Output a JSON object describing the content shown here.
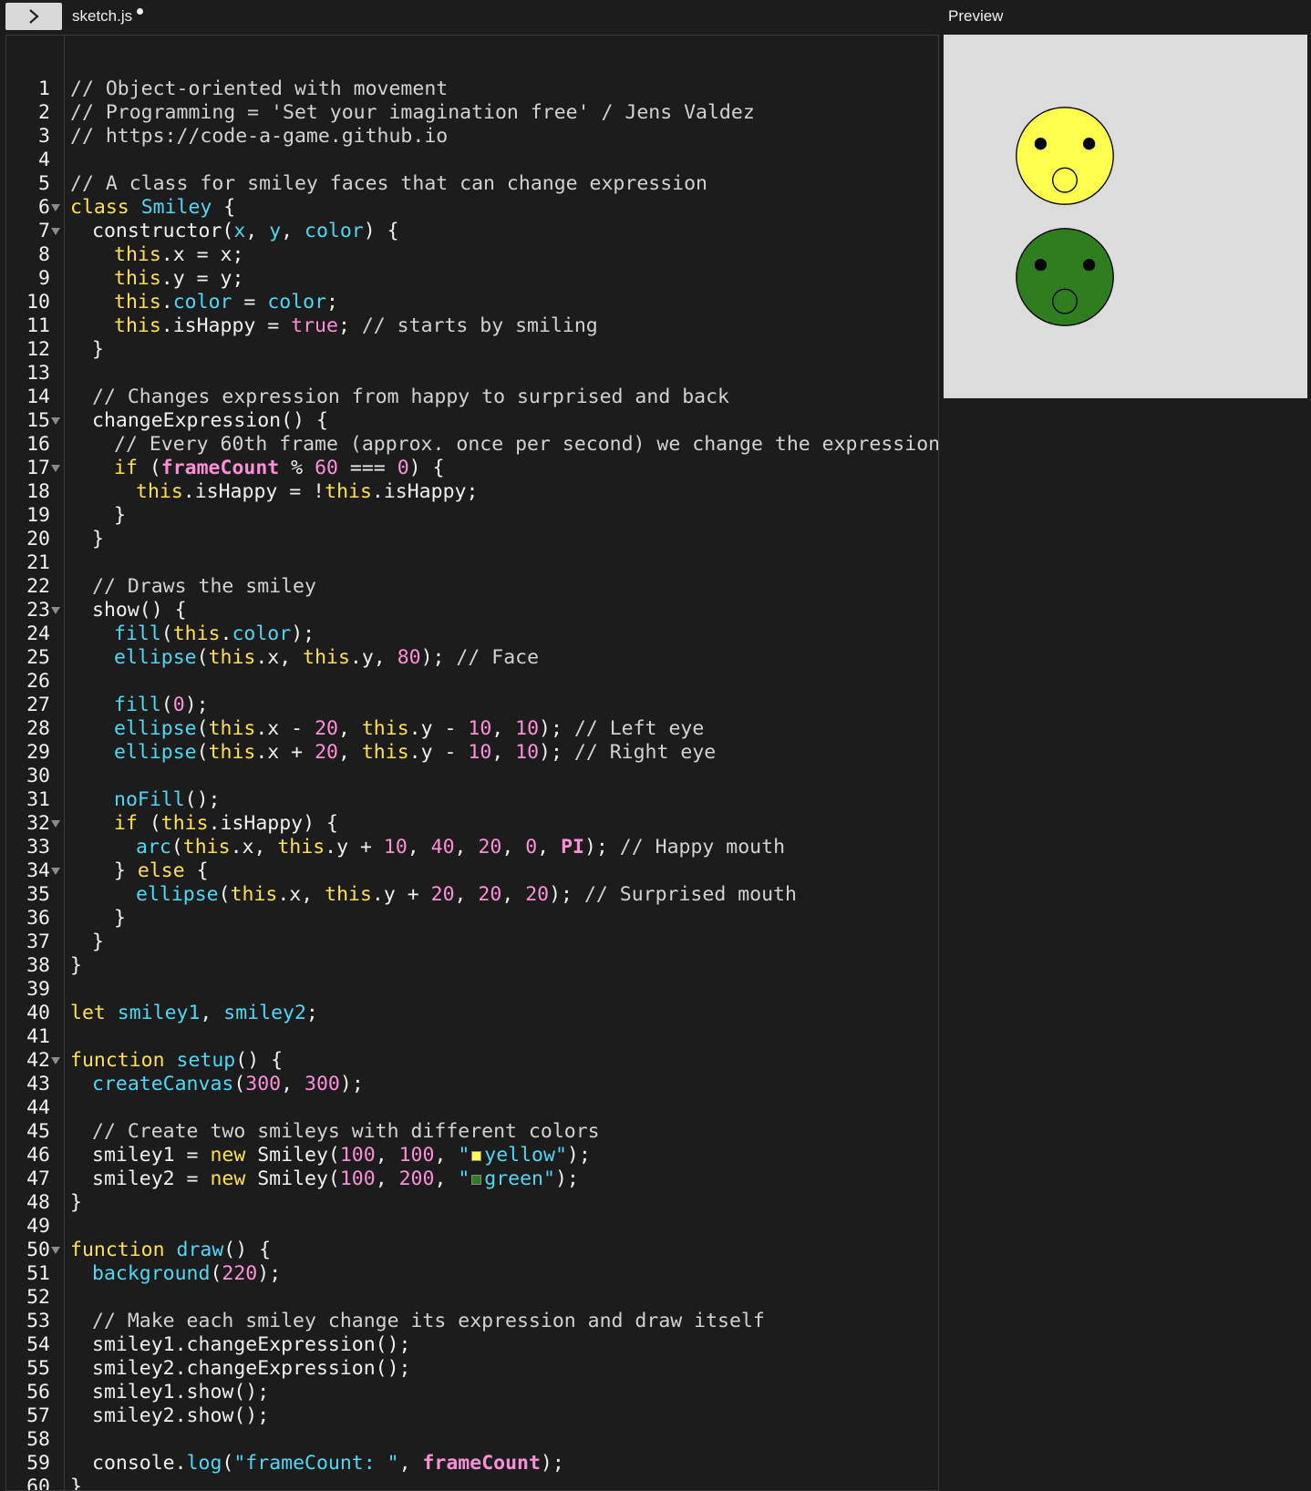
{
  "toolbar": {
    "toggle_icon": "chevron-right-icon"
  },
  "file_tab": {
    "name": "sketch.js"
  },
  "preview": {
    "label": "Preview",
    "background": "#dcdcdc",
    "smileys": [
      {
        "color": "#ffff4d",
        "expression": "surprised"
      },
      {
        "color": "#2e7d1e",
        "expression": "surprised"
      }
    ]
  },
  "colors": {
    "editor_bg": "#1c1c1c",
    "keyword": "#ffe14d",
    "function": "#4ed8f5",
    "number": "#ff8fd8",
    "swatch_yellow": "#ffff4d",
    "swatch_green": "#2e7d1e"
  },
  "code": {
    "l1": "// Object-oriented with movement",
    "l2": "// Programming = 'Set your imagination free' / Jens Valdez",
    "l3": "// https://code-a-game.github.io",
    "l5": "// A class for smiley faces that can change expression",
    "l14": "// Changes expression from happy to surprised and back",
    "l16": "// Every 60th frame (approx. once per second) we change the expression",
    "l22": "// Draws the smiley",
    "l25c": "// Face",
    "l28c": "// Left eye",
    "l29c": "// Right eye",
    "l33c": "// Happy mouth",
    "l35c": "// Surprised mouth",
    "l45": "// Create two smileys with different colors",
    "l53": "// Make each smiley change its expression and draw itself",
    "l11c": "// starts by smiling"
  }
}
